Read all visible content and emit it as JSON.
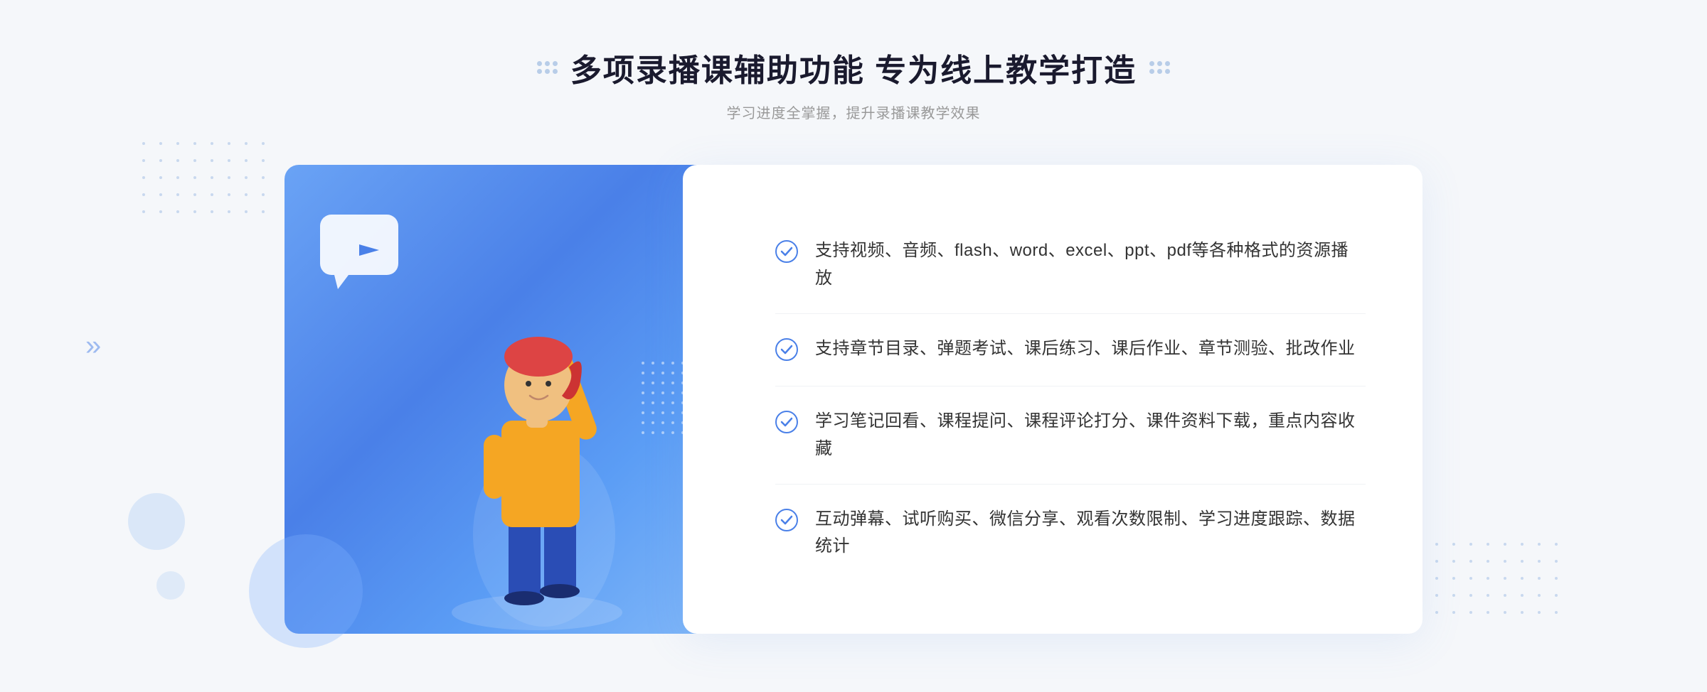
{
  "header": {
    "title": "多项录播课辅助功能 专为线上教学打造",
    "subtitle": "学习进度全掌握，提升录播课教学效果",
    "deco_left_label": "six-dots-left",
    "deco_right_label": "six-dots-right"
  },
  "features": [
    {
      "id": 1,
      "text": "支持视频、音频、flash、word、excel、ppt、pdf等各种格式的资源播放"
    },
    {
      "id": 2,
      "text": "支持章节目录、弹题考试、课后练习、课后作业、章节测验、批改作业"
    },
    {
      "id": 3,
      "text": "学习笔记回看、课程提问、课程评论打分、课件资料下载，重点内容收藏"
    },
    {
      "id": 4,
      "text": "互动弹幕、试听购买、微信分享、观看次数限制、学习进度跟踪、数据统计"
    }
  ],
  "colors": {
    "primary_blue": "#4a80e8",
    "light_blue": "#82b8f8",
    "check_blue": "#4a80e8",
    "text_dark": "#333333",
    "text_light": "#999999"
  },
  "icons": {
    "check": "✓",
    "play": "▶",
    "arrow_right": "»"
  }
}
